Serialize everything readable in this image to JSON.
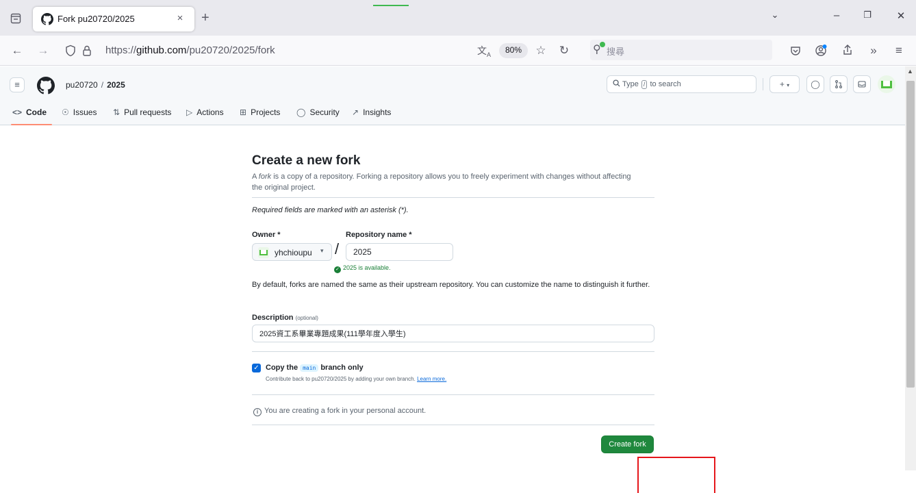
{
  "browser": {
    "tab_title": "Fork pu20720/2025",
    "tab_close": "×",
    "new_tab": "+",
    "url_prefix": "https://",
    "url_host": "github.com",
    "url_path": "/pu20720/2025/fork",
    "zoom": "80%",
    "search_placeholder": "搜尋",
    "icons": [
      "tab-list-icon",
      "github-favicon",
      "back-icon",
      "forward-icon",
      "shield-icon",
      "lock-icon",
      "translate-icon",
      "star-icon",
      "reload-icon",
      "search-engine-icon",
      "pocket-icon",
      "account-icon",
      "share-icon",
      "overflow-icon",
      "menu-icon",
      "minimize-icon",
      "restore-icon",
      "close-icon",
      "list-all-tabs-icon"
    ]
  },
  "github": {
    "owner": "pu20720",
    "separator": "/",
    "repo": "2025",
    "search_prefix": "Type",
    "search_key": "/",
    "search_suffix": "to search",
    "nav": [
      {
        "label": "Code",
        "icon": "code-icon",
        "selected": true
      },
      {
        "label": "Issues",
        "icon": "issue-icon"
      },
      {
        "label": "Pull requests",
        "icon": "pull-request-icon"
      },
      {
        "label": "Actions",
        "icon": "play-icon"
      },
      {
        "label": "Projects",
        "icon": "table-icon"
      },
      {
        "label": "Security",
        "icon": "shield-icon"
      },
      {
        "label": "Insights",
        "icon": "graph-icon"
      }
    ]
  },
  "form": {
    "title": "Create a new fork",
    "intro_em": "fork",
    "intro_before": "A",
    "intro_after": "is a copy of a repository. Forking a repository allows you to freely experiment with changes without affecting the original project.",
    "required_note": "Required fields are marked with an asterisk (*).",
    "owner_label": "Owner *",
    "owner_value": "yhchioupu",
    "repo_label": "Repository name *",
    "repo_value": "2025",
    "availability": "2025 is available.",
    "help": "By default, forks are named the same as their upstream repository. You can customize the name to distinguish it further.",
    "description_label": "Description",
    "description_optional": "(optional)",
    "description_value": "2025資工系畢業專題成果(111學年度入學生)",
    "copy_checked": true,
    "copy_before": "Copy the",
    "copy_branch": "main",
    "copy_after": "branch only",
    "copy_sub": "Contribute back to pu20720/2025 by adding your own branch.",
    "learn_more": "Learn more.",
    "info": "You are creating a fork in your personal account.",
    "submit": "Create fork"
  },
  "colors": {
    "primary_button": "#1f883d",
    "link": "#0969da",
    "success": "#1a7f37",
    "nav_underline": "#fd8c73",
    "highlight_box": "#e5161a"
  }
}
